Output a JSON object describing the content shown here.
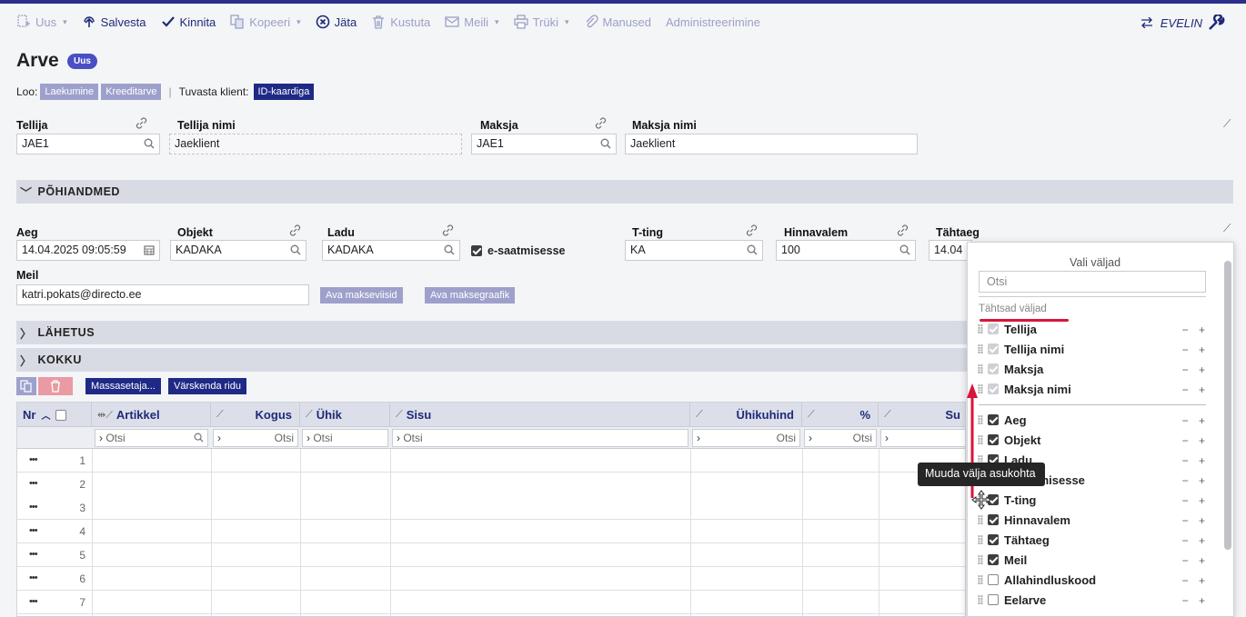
{
  "toolbar": {
    "new": "Uus",
    "save": "Salvesta",
    "confirm": "Kinnita",
    "copy": "Kopeeri",
    "leave": "Jäta",
    "delete": "Kustuta",
    "mail": "Meili",
    "print": "Trüki",
    "attachments": "Manused",
    "admin": "Administreerimine",
    "user": "EVELIN"
  },
  "page": {
    "title": "Arve",
    "status_badge": "Uus",
    "create_label": "Loo:",
    "create_payment": "Laekumine",
    "create_credit": "Kreeditarve",
    "verify_label": "Tuvasta klient:",
    "verify_button": "ID-kaardiga"
  },
  "header_fields": {
    "tellija_label": "Tellija",
    "tellija_value": "JAE1",
    "tellija_nimi_label": "Tellija nimi",
    "tellija_nimi_value": "Jaeklient",
    "maksja_label": "Maksja",
    "maksja_value": "JAE1",
    "maksja_nimi_label": "Maksja nimi",
    "maksja_nimi_value": "Jaeklient"
  },
  "sections": {
    "main": "PÕHIANDMED",
    "shipping": "LÄHETUS",
    "total": "KOKKU"
  },
  "main_fields": {
    "aeg_label": "Aeg",
    "aeg_value": "14.04.2025 09:05:59",
    "objekt_label": "Objekt",
    "objekt_value": "KADAKA",
    "ladu_label": "Ladu",
    "ladu_value": "KADAKA",
    "esaatmine_label": "e-saatmisesse",
    "tting_label": "T-ting",
    "tting_value": "KA",
    "hinnavalem_label": "Hinnavalem",
    "hinnavalem_value": "100",
    "tahtaeg_label": "Tähtaeg",
    "tahtaeg_value": "14.04",
    "meil_label": "Meil",
    "meil_value": "katri.pokats@directo.ee",
    "payment_methods_button": "Ava makseviisid",
    "payment_schedule_button": "Ava maksegraafik"
  },
  "rows_toolbar": {
    "mass_setter": "Massasetaja...",
    "refresh_rows": "Värskenda ridu"
  },
  "grid": {
    "columns": [
      "Nr",
      "Artikkel",
      "Kogus",
      "Ühik",
      "Sisu",
      "Ühikuhind",
      "%",
      "Su"
    ],
    "filter_placeholder": "Otsi",
    "row_numbers": [
      "1",
      "2",
      "3",
      "4",
      "5",
      "6",
      "7"
    ],
    "row_menu": "•••"
  },
  "field_panel": {
    "title": "Vali väljad",
    "search_placeholder": "Otsi",
    "important_label": "Tähtsad väljad",
    "important_items": [
      "Tellija",
      "Tellija nimi",
      "Maksja",
      "Maksja nimi"
    ],
    "items": [
      {
        "label": "Aeg",
        "checked": true
      },
      {
        "label": "Objekt",
        "checked": true
      },
      {
        "label": "Ladu",
        "checked": true
      },
      {
        "label": "e-saatmisesse",
        "checked": true
      },
      {
        "label": "T-ting",
        "checked": true
      },
      {
        "label": "Hinnavalem",
        "checked": true
      },
      {
        "label": "Tähtaeg",
        "checked": true
      },
      {
        "label": "Meil",
        "checked": true
      },
      {
        "label": "Allahindluskood",
        "checked": false
      },
      {
        "label": "Eelarve",
        "checked": false
      }
    ],
    "minus_plus": "− +",
    "tooltip": "Muuda välja asukohta"
  },
  "colors": {
    "accent": "#1f2a86",
    "badge": "#4a4fc4",
    "arrow": "#d9143a"
  }
}
